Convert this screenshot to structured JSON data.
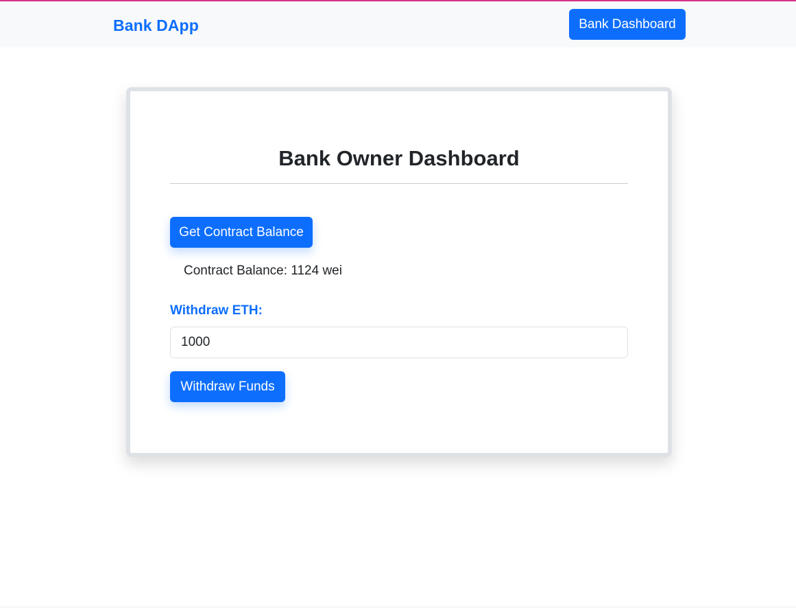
{
  "navbar": {
    "brand": "Bank DApp",
    "dashboard_button": "Bank Dashboard"
  },
  "card": {
    "title": "Bank Owner Dashboard",
    "get_balance_button": "Get Contract Balance",
    "balance_text": "Contract Balance: 1124 wei",
    "withdraw_label": "Withdraw ETH:",
    "withdraw_input_value": "1000",
    "withdraw_button": "Withdraw Funds"
  },
  "colors": {
    "primary": "#0d6efd",
    "accent_top": "#d63384",
    "navbar_bg": "#f8f9fa",
    "card_border": "#dee2e6"
  }
}
